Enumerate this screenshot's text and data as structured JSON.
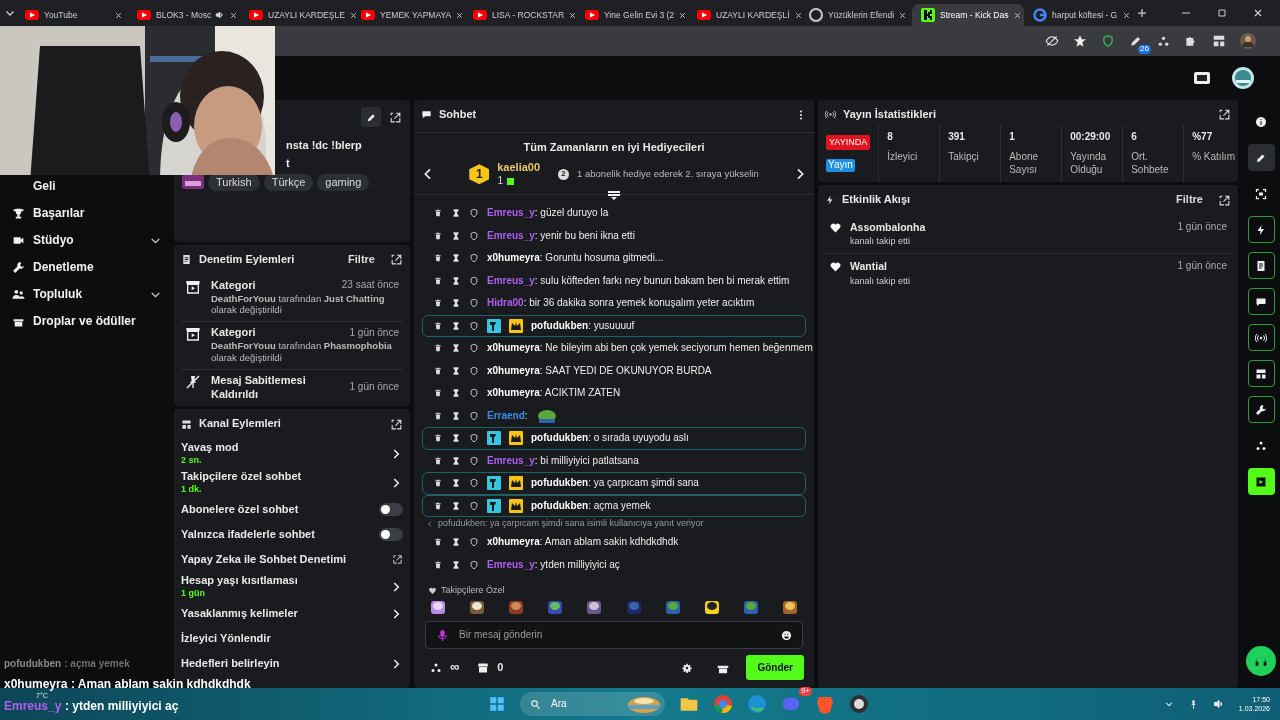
{
  "browser": {
    "tabs": [
      {
        "title": "YouTube",
        "kind": "youtube",
        "selected": false,
        "audio": false
      },
      {
        "title": "BLOK3 - Mosc",
        "kind": "youtube",
        "selected": false,
        "audio": true
      },
      {
        "title": "UZAYLI KARDEŞLE",
        "kind": "youtube",
        "selected": false,
        "audio": false
      },
      {
        "title": "YEMEK YAPMAYA",
        "kind": "youtube",
        "selected": false,
        "audio": false
      },
      {
        "title": "LISA - ROCKSTAR",
        "kind": "youtube",
        "selected": false,
        "audio": false
      },
      {
        "title": "Yine Gelin Evi 3 (2",
        "kind": "youtube",
        "selected": false,
        "audio": false
      },
      {
        "title": "UZAYLI KARDEŞLİ",
        "kind": "youtube",
        "selected": false,
        "audio": false
      },
      {
        "title": "Yüzüklerin Efendi",
        "kind": "ring",
        "selected": false,
        "audio": false
      },
      {
        "title": "Stream - Kick Das",
        "kind": "kick",
        "selected": true,
        "audio": false
      },
      {
        "title": "harput köftesi - G",
        "kind": "google",
        "selected": false,
        "audio": false
      }
    ],
    "extension_badge": "26"
  },
  "sidebar": {
    "items": [
      {
        "label": "Geli",
        "kind": "link"
      },
      {
        "label": "Başarılar",
        "kind": "link"
      },
      {
        "label": "Stüdyo",
        "kind": "group"
      },
      {
        "label": "Denetleme",
        "kind": "link"
      },
      {
        "label": "Topluluk",
        "kind": "group"
      },
      {
        "label": "Droplar ve ödüller",
        "kind": "link"
      }
    ]
  },
  "stream_info": {
    "description": "nsta !dc !blerp",
    "description_tail": "t",
    "tags": [
      "Turkish",
      "Türkçe",
      "gaming"
    ]
  },
  "mod_actions": {
    "title": "Denetim Eylemleri",
    "filter": "Filtre",
    "items": [
      {
        "kind": "category",
        "title": "Kategori",
        "time": "23 saat önce",
        "detail": "**DeathForYouu** tarafından **Just Chatting** olarak değiştirildi"
      },
      {
        "kind": "category",
        "title": "Kategori",
        "time": "1 gün önce",
        "detail": "**DeathForYouu** tarafından **Phasmophobia** olarak değiştirildi"
      },
      {
        "kind": "unpin",
        "title": "Mesaj Sabitlemesi Kaldırıldı",
        "time": "1 gün önce"
      }
    ]
  },
  "channel_actions": {
    "title": "Kanal Eylemleri",
    "items": [
      {
        "label": "Yavaş mod",
        "value": "2 sn.",
        "kind": "chevron"
      },
      {
        "label": "Takipçilere özel sohbet",
        "value": "1 dk.",
        "kind": "chevron"
      },
      {
        "label": "Abonelere özel sohbet",
        "kind": "toggle",
        "on": false
      },
      {
        "label": "Yalnızca ifadelerle sohbet",
        "kind": "toggle",
        "on": false
      },
      {
        "label": "Yapay Zeka ile Sohbet Denetimi",
        "kind": "external"
      },
      {
        "label": "Hesap yaşı kısıtlaması",
        "value": "1 gün",
        "kind": "chevron"
      },
      {
        "label": "Yasaklanmış kelimeler",
        "kind": "chevron"
      },
      {
        "label": "İzleyici Yönlendir",
        "kind": "plain"
      },
      {
        "label": "Hedefleri belirleyin",
        "kind": "chevron"
      }
    ]
  },
  "chat": {
    "title": "Sohbet",
    "gifters": {
      "title": "Tüm Zamanların en iyi Hediyecileri",
      "top_rank": "1",
      "top_name": "kaelia00",
      "top_count": "1",
      "next_rank": "2",
      "next_text": "1 abonelik hediye ederek 2. sıraya yükselin"
    },
    "messages": [
      {
        "kind": "message",
        "user": "Emreus_y",
        "color": "#b15ef2",
        "text": ": güzel duruyo la",
        "highlighted": false,
        "badged": false
      },
      {
        "kind": "message",
        "user": "Emreus_y",
        "color": "#b15ef2",
        "text": ": yenir bu beni ikna etti",
        "highlighted": false,
        "badged": false
      },
      {
        "kind": "message",
        "user": "x0humeyra",
        "color": "#ffffff",
        "text": ": Goruntu hosuma gitmedi...",
        "highlighted": false,
        "badged": false
      },
      {
        "kind": "message",
        "user": "Emreus_y",
        "color": "#b15ef2",
        "text": ": sulu köfteden farkı ney bunun bakam ben bi merak ettim",
        "highlighted": false,
        "badged": false
      },
      {
        "kind": "message",
        "user": "Hidra00",
        "color": "#b15ef2",
        "text": ": bir 36 dakika sonra yemek konuşalım yeter acıktım",
        "highlighted": false,
        "badged": false
      },
      {
        "kind": "message",
        "user": "pofudukben",
        "color": "#ffffff",
        "text": ": yusuuuuf",
        "highlighted": true,
        "badged": true
      },
      {
        "kind": "message",
        "user": "x0humeyra",
        "color": "#ffffff",
        "text": ": Ne bileyim abi ben çok yemek seciyorum hemen beğenmem",
        "highlighted": false,
        "badged": false
      },
      {
        "kind": "message",
        "user": "x0humeyra",
        "color": "#ffffff",
        "text": ": SAAT YEDI DE OKUNUYOR BURDA",
        "highlighted": false,
        "badged": false
      },
      {
        "kind": "message",
        "user": "x0humeyra",
        "color": "#ffffff",
        "text": ": ACIKTIM ZATEN",
        "highlighted": false,
        "badged": false
      },
      {
        "kind": "emote",
        "user": "Erraend",
        "color": "#3d8bf0",
        "text": ":",
        "highlighted": false,
        "badged": false
      },
      {
        "kind": "message",
        "user": "pofudukben",
        "color": "#ffffff",
        "text": ": o sırada uyuyodu aslı",
        "highlighted": true,
        "badged": true
      },
      {
        "kind": "message",
        "user": "Emreus_y",
        "color": "#b15ef2",
        "text": ": bi milliyiyici patlatsana",
        "highlighted": false,
        "badged": false
      },
      {
        "kind": "message",
        "user": "pofudukben",
        "color": "#ffffff",
        "text": ": ya çarpıcam şimdi sana",
        "highlighted": true,
        "badged": true
      },
      {
        "kind": "message",
        "user": "pofudukben",
        "color": "#ffffff",
        "text": ": açma yemek",
        "highlighted": true,
        "badged": true
      },
      {
        "kind": "reply_note",
        "text": "pofudukben: ya çarpıcam şimdi sana isimli kullanıcıya yanıt veriyor"
      },
      {
        "kind": "message",
        "user": "x0humeyra",
        "color": "#ffffff",
        "text": ": Aman ablam sakin kdhdkdhdk",
        "highlighted": false,
        "badged": false
      },
      {
        "kind": "message",
        "user": "Emreus_y",
        "color": "#b15ef2",
        "text": ": ytden milliyiyici aç",
        "highlighted": false,
        "badged": false
      }
    ],
    "emote_label": "Takipçilere Özel",
    "input": {
      "placeholder": "Bir mesaj gönderin"
    },
    "points": "∞",
    "kicks": "0",
    "send": "Gönder"
  },
  "stats": {
    "title": "Yayın İstatistikleri",
    "live": "YAYINDA",
    "live_tag": "Yayın",
    "items": [
      {
        "value": "8",
        "label": "İzleyici"
      },
      {
        "value": "391",
        "label": "Takipçi"
      },
      {
        "value": "1",
        "label": "Abone Sayısı"
      },
      {
        "value": "00:29:00",
        "label": "Yayında Olduğu"
      },
      {
        "value": "6",
        "label": "Ort. Sohbete"
      },
      {
        "value": "%77",
        "label": "% Katılım"
      }
    ]
  },
  "events": {
    "title": "Etkinlik Akışı",
    "filter": "Filtre",
    "items": [
      {
        "user": "Assombalonha",
        "action": "kanalı takip etti",
        "time": "1 gün önce"
      },
      {
        "user": "Wantial",
        "action": "kanalı takip etti",
        "time": "1 gün önce"
      }
    ]
  },
  "rail": {
    "buttons": [
      {
        "kind": "plain"
      },
      {
        "kind": "selected"
      },
      {
        "kind": "plain"
      },
      {
        "kind": "outlined"
      },
      {
        "kind": "outlined"
      },
      {
        "kind": "outlined"
      },
      {
        "kind": "outlined"
      },
      {
        "kind": "outlined"
      },
      {
        "kind": "outlined"
      },
      {
        "kind": "plain"
      },
      {
        "kind": "filled"
      }
    ]
  },
  "stream_overlay": [
    {
      "user": "pofudukben",
      "text": ": açma yemek",
      "color": "#8a8a8a",
      "faded": true
    },
    {
      "user": "x0humeyra",
      "text": ": Aman ablam sakin kdhdkdhdk",
      "color": "#ffffff",
      "faded": false
    },
    {
      "user": "Emreus_y",
      "text": ": ytden milliyiyici aç",
      "color": "#b15ef2",
      "faded": false
    }
  ],
  "taskbar": {
    "weather": "7°C",
    "search_placeholder": "Ara",
    "discord_badge": "9+",
    "time": "17:50",
    "date": "1.03.2026"
  }
}
